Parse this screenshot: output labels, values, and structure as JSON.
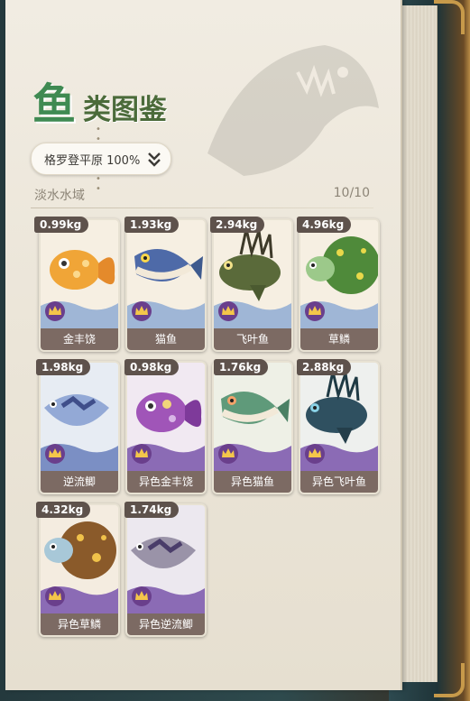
{
  "title": {
    "big": "鱼",
    "rest": "类图鉴"
  },
  "region": {
    "label": "格罗登平原 100%"
  },
  "water": {
    "name": "淡水水域",
    "count": "10/10"
  },
  "fish": [
    {
      "name": "金丰饶",
      "weight": "0.99kg"
    },
    {
      "name": "猫鱼",
      "weight": "1.93kg"
    },
    {
      "name": "飞叶鱼",
      "weight": "2.94kg"
    },
    {
      "name": "草鳞",
      "weight": "4.96kg"
    },
    {
      "name": "逆流鲫",
      "weight": "1.98kg"
    },
    {
      "name": "异色金丰饶",
      "weight": "0.98kg"
    },
    {
      "name": "异色猫鱼",
      "weight": "1.76kg"
    },
    {
      "name": "异色飞叶鱼",
      "weight": "2.88kg"
    },
    {
      "name": "异色草鳞",
      "weight": "4.32kg"
    },
    {
      "name": "异色逆流鲫",
      "weight": "1.74kg"
    }
  ]
}
